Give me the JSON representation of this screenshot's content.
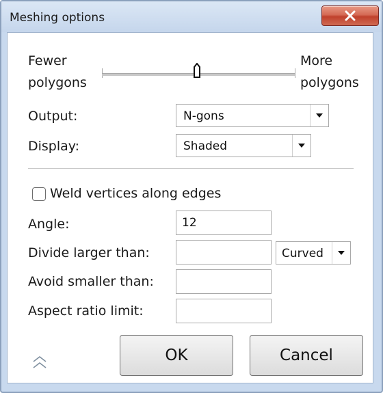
{
  "window": {
    "title": "Meshing options",
    "close_icon": "close-icon"
  },
  "slider": {
    "left_label_line1": "Fewer",
    "left_label_line2": "polygons",
    "right_label_line1": "More",
    "right_label_line2": "polygons",
    "level_fraction": 0.5
  },
  "output": {
    "label": "Output:",
    "value": "N-gons"
  },
  "display": {
    "label": "Display:",
    "value": "Shaded"
  },
  "weld": {
    "label": "Weld vertices along edges",
    "checked": false
  },
  "angle": {
    "label": "Angle:",
    "value": "12"
  },
  "divide": {
    "label": "Divide larger than:",
    "value": "",
    "mode": "Curved"
  },
  "avoid": {
    "label": "Avoid smaller than:",
    "value": ""
  },
  "aspect": {
    "label": "Aspect ratio limit:",
    "value": ""
  },
  "buttons": {
    "ok": "OK",
    "cancel": "Cancel"
  },
  "colors": {
    "close_button": "#c9503d",
    "title_bar": "#c8d9ee"
  }
}
